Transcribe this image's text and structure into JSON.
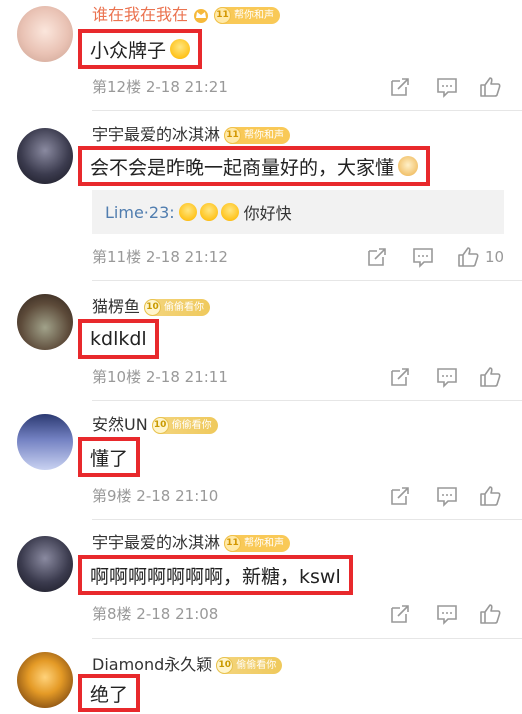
{
  "comments": [
    {
      "username": "谁在我在我在",
      "badge_num": "11",
      "badge_label": "帮你和声",
      "text": "小众牌子",
      "emoji": "shock-emoji",
      "meta": "第12楼  2-18  21:21",
      "likes": ""
    },
    {
      "username": "宇宇最爱的冰淇淋",
      "badge_num": "11",
      "badge_label": "帮你和声",
      "text": "会不会是昨晚一起商量好的，大家懂",
      "emoji": "doge-emoji",
      "reply_author": "Lime",
      "reply_sep": "·",
      "reply_num": "23:",
      "reply_text": "你好快",
      "meta": "第11楼  2-18  21:12",
      "likes": "10"
    },
    {
      "username": "猫楞鱼",
      "badge_num": "10",
      "badge_label": "偷偷看你",
      "text": "kdlkdl",
      "meta": "第10楼  2-18  21:11",
      "likes": ""
    },
    {
      "username": "安然UN",
      "badge_num": "10",
      "badge_label": "偷偷看你",
      "text": "懂了",
      "meta": "第9楼  2-18  21:10",
      "likes": ""
    },
    {
      "username": "宇宇最爱的冰淇淋",
      "badge_num": "11",
      "badge_label": "帮你和声",
      "text": "啊啊啊啊啊啊啊，新糖，kswl",
      "meta": "第8楼  2-18  21:08",
      "likes": ""
    },
    {
      "username": "Diamond永久颖",
      "badge_num": "10",
      "badge_label": "偷偷看你",
      "text": "绝了"
    }
  ],
  "colors": {
    "highlight_border": "#e8292c",
    "username_orange": "#eb7350",
    "reply_author": "#507daf",
    "meta_gray": "#999999"
  },
  "icons": [
    "share-icon",
    "comment-icon",
    "like-icon",
    "crown-icon",
    "laugh-emoji"
  ]
}
